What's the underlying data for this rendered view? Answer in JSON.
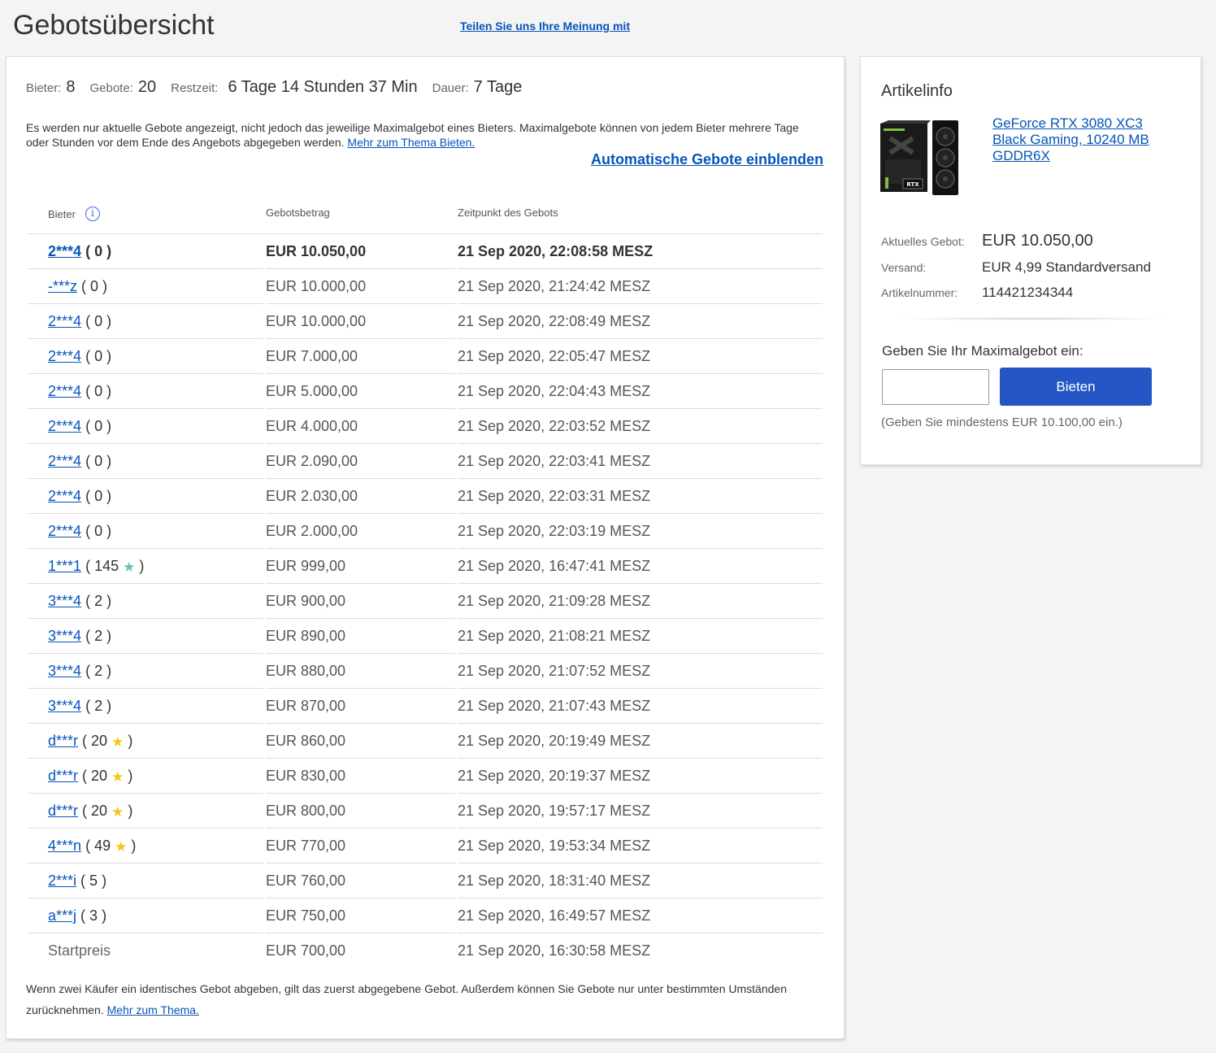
{
  "header": {
    "title": "Gebotsübersicht",
    "feedback_link": "Teilen Sie uns Ihre Meinung mit"
  },
  "summary": {
    "bidders_label": "Bieter:",
    "bidders_value": "8",
    "bids_label": "Gebote:",
    "bids_value": "20",
    "remaining_label": "Restzeit:",
    "remaining_value": "6 Tage 14 Stunden 37 Min",
    "duration_label": "Dauer:",
    "duration_value": "7 Tage"
  },
  "info": {
    "text": "Es werden nur aktuelle Gebote angezeigt, nicht jedoch das jeweilige Maximalgebot eines Bieters. Maximalgebote können von jedem Bieter mehrere Tage oder Stunden vor dem Ende des Angebots abgegeben werden.",
    "link": "Mehr zum Thema Bieten.",
    "auto_bids_link": "Automatische Gebote einblenden"
  },
  "table": {
    "col_bidder": "Bieter",
    "col_amount": "Gebotsbetrag",
    "col_time": "Zeitpunkt des Gebots",
    "info_icon": "i",
    "rows": [
      {
        "bidder": "2***4",
        "feedback": "0",
        "star": "",
        "amount": "EUR 10.050,00",
        "time": "21 Sep 2020, 22:08:58 MESZ",
        "top": true
      },
      {
        "bidder": "-***z",
        "feedback": "0",
        "star": "",
        "amount": "EUR 10.000,00",
        "time": "21 Sep 2020, 21:24:42 MESZ"
      },
      {
        "bidder": "2***4",
        "feedback": "0",
        "star": "",
        "amount": "EUR 10.000,00",
        "time": "21 Sep 2020, 22:08:49 MESZ"
      },
      {
        "bidder": "2***4",
        "feedback": "0",
        "star": "",
        "amount": "EUR 7.000,00",
        "time": "21 Sep 2020, 22:05:47 MESZ"
      },
      {
        "bidder": "2***4",
        "feedback": "0",
        "star": "",
        "amount": "EUR 5.000,00",
        "time": "21 Sep 2020, 22:04:43 MESZ"
      },
      {
        "bidder": "2***4",
        "feedback": "0",
        "star": "",
        "amount": "EUR 4.000,00",
        "time": "21 Sep 2020, 22:03:52 MESZ"
      },
      {
        "bidder": "2***4",
        "feedback": "0",
        "star": "",
        "amount": "EUR 2.090,00",
        "time": "21 Sep 2020, 22:03:41 MESZ"
      },
      {
        "bidder": "2***4",
        "feedback": "0",
        "star": "",
        "amount": "EUR 2.030,00",
        "time": "21 Sep 2020, 22:03:31 MESZ"
      },
      {
        "bidder": "2***4",
        "feedback": "0",
        "star": "",
        "amount": "EUR 2.000,00",
        "time": "21 Sep 2020, 22:03:19 MESZ"
      },
      {
        "bidder": "1***1",
        "feedback": "145",
        "star": "teal",
        "amount": "EUR 999,00",
        "time": "21 Sep 2020, 16:47:41 MESZ"
      },
      {
        "bidder": "3***4",
        "feedback": "2",
        "star": "",
        "amount": "EUR 900,00",
        "time": "21 Sep 2020, 21:09:28 MESZ"
      },
      {
        "bidder": "3***4",
        "feedback": "2",
        "star": "",
        "amount": "EUR 890,00",
        "time": "21 Sep 2020, 21:08:21 MESZ"
      },
      {
        "bidder": "3***4",
        "feedback": "2",
        "star": "",
        "amount": "EUR 880,00",
        "time": "21 Sep 2020, 21:07:52 MESZ"
      },
      {
        "bidder": "3***4",
        "feedback": "2",
        "star": "",
        "amount": "EUR 870,00",
        "time": "21 Sep 2020, 21:07:43 MESZ"
      },
      {
        "bidder": "d***r",
        "feedback": "20",
        "star": "gold",
        "amount": "EUR 860,00",
        "time": "21 Sep 2020, 20:19:49 MESZ"
      },
      {
        "bidder": "d***r",
        "feedback": "20",
        "star": "gold",
        "amount": "EUR 830,00",
        "time": "21 Sep 2020, 20:19:37 MESZ"
      },
      {
        "bidder": "d***r",
        "feedback": "20",
        "star": "gold",
        "amount": "EUR 800,00",
        "time": "21 Sep 2020, 19:57:17 MESZ"
      },
      {
        "bidder": "4***n",
        "feedback": "49",
        "star": "gold",
        "amount": "EUR 770,00",
        "time": "21 Sep 2020, 19:53:34 MESZ"
      },
      {
        "bidder": "2***i",
        "feedback": "5",
        "star": "",
        "amount": "EUR 760,00",
        "time": "21 Sep 2020, 18:31:40 MESZ"
      },
      {
        "bidder": "a***j",
        "feedback": "3",
        "star": "",
        "amount": "EUR 750,00",
        "time": "21 Sep 2020, 16:49:57 MESZ"
      }
    ],
    "starting": {
      "label": "Startpreis",
      "amount": "EUR 700,00",
      "time": "21 Sep 2020, 16:30:58 MESZ"
    }
  },
  "footer": {
    "text": "Wenn zwei Käufer ein identisches Gebot abgeben, gilt das zuerst abgegebene Gebot. Außerdem können Sie Gebote nur unter bestimmten Umständen zurücknehmen.",
    "link": "Mehr zum Thema."
  },
  "item": {
    "title": "Artikelinfo",
    "product_name": "GeForce RTX 3080 XC3 Black Gaming, 10240 MB GDDR6X",
    "current_bid_label": "Aktuelles Gebot:",
    "current_bid_value": "EUR 10.050,00",
    "shipping_label": "Versand:",
    "shipping_value": "EUR 4,99 Standardversand",
    "item_number_label": "Artikelnummer:",
    "item_number_value": "114421234344",
    "image_icon": "graphics-card-box-image",
    "image_text": "RTX"
  },
  "bid_form": {
    "label": "Geben Sie Ihr Maximalgebot ein:",
    "input_value": "",
    "button": "Bieten",
    "hint": "(Geben Sie mindestens EUR 10.100,00 ein.)"
  },
  "colors": {
    "link": "#0654ba",
    "button": "#2457c5",
    "star_gold": "#f5c518",
    "star_teal": "#5ec2b6"
  }
}
